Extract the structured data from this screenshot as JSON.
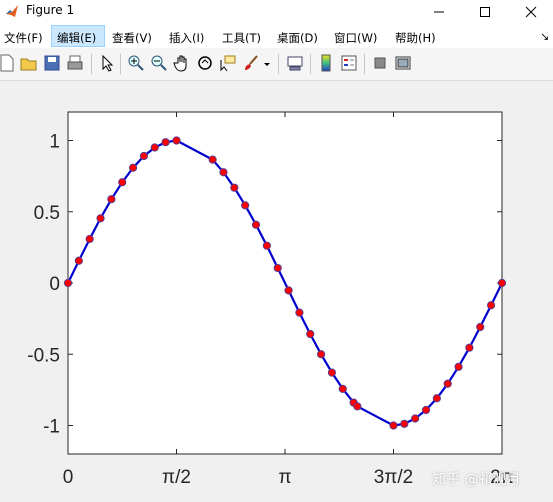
{
  "window": {
    "title": "Figure 1",
    "minimize_glyph": "minimize-icon",
    "maximize_glyph": "maximize-icon",
    "close_glyph": "close-icon"
  },
  "menubar": {
    "items": [
      {
        "label": "文件(F)",
        "selected": false
      },
      {
        "label": "编辑(E)",
        "selected": true
      },
      {
        "label": "查看(V)",
        "selected": false
      },
      {
        "label": "插入(I)",
        "selected": false
      },
      {
        "label": "工具(T)",
        "selected": false
      },
      {
        "label": "桌面(D)",
        "selected": false
      },
      {
        "label": "窗口(W)",
        "selected": false
      },
      {
        "label": "帮助(H)",
        "selected": false
      }
    ],
    "overflow_icon": "overflow-arrow-icon"
  },
  "toolbar": {
    "icons": [
      "new-figure-icon",
      "open-file-icon",
      "save-icon",
      "print-icon",
      "edit-plot-arrow-icon",
      "zoom-in-icon",
      "zoom-out-icon",
      "pan-hand-icon",
      "rotate-3d-icon",
      "data-cursor-icon",
      "brush-icon",
      "brush-dropdown-icon",
      "link-plot-icon",
      "colorbar-icon",
      "legend-icon",
      "hide-plot-tools-icon",
      "show-plot-tools-icon"
    ]
  },
  "watermark": "知乎 @祁观月",
  "chart_data": {
    "type": "line",
    "title": "",
    "xlabel": "",
    "ylabel": "",
    "xlim": [
      0,
      6.2832
    ],
    "ylim": [
      -1.2,
      1.2
    ],
    "xticks": [
      "0",
      "π/2",
      "π",
      "3π/2",
      "2π"
    ],
    "yticks": [
      "1",
      "0.5",
      "0",
      "-0.5",
      "-1"
    ],
    "grid": false,
    "line_color": "#0000cc",
    "marker_color": "#ff0000",
    "marker_edge_color": "#5a3a8c",
    "series": [
      {
        "x": [
          0,
          0.157,
          0.314,
          0.471,
          0.628,
          0.785,
          0.942,
          1.099,
          1.256,
          1.413,
          1.571,
          2.094,
          2.251,
          2.408,
          2.565,
          2.722,
          2.879,
          3.036,
          3.193,
          3.35,
          3.507,
          3.664,
          3.821,
          3.978,
          4.135,
          4.189,
          4.712,
          4.869,
          5.026,
          5.183,
          5.34,
          5.497,
          5.654,
          5.811,
          5.968,
          6.125,
          6.283
        ],
        "y": [
          0,
          0.156,
          0.309,
          0.454,
          0.588,
          0.707,
          0.809,
          0.891,
          0.951,
          0.988,
          1.0,
          0.866,
          0.777,
          0.669,
          0.545,
          0.409,
          0.262,
          0.105,
          -0.052,
          -0.208,
          -0.358,
          -0.5,
          -0.629,
          -0.743,
          -0.839,
          -0.866,
          -1.0,
          -0.988,
          -0.951,
          -0.891,
          -0.809,
          -0.707,
          -0.588,
          -0.454,
          -0.309,
          -0.156,
          0
        ]
      }
    ]
  }
}
